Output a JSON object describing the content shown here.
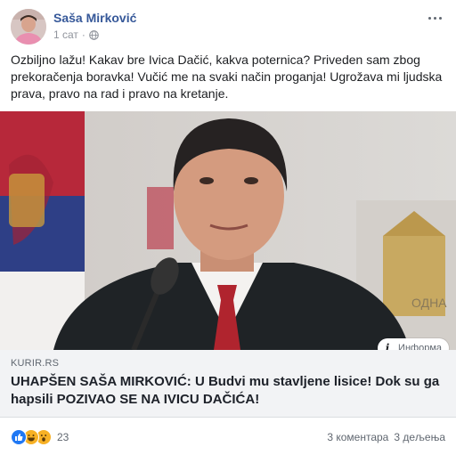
{
  "post": {
    "author": "Saša Mirković",
    "timestamp": "1 сат",
    "privacy_icon": "globe-icon",
    "text": "Ozbiljno lažu! Kakav bre Ivica Dačić, kakva poternica? Priveden sam zbog prekoračenja boravka! Vučić me na svaki način proganja! Ugrožava mi ljudska prava, pravo na rad i pravo na kretanje."
  },
  "link_preview": {
    "info_label": "Информа",
    "domain": "KURIR.RS",
    "title": "UHAPŠEN SAŠA MIRKOVIĆ: U Budvi mu stavljene lisice! Dok su ga hapsili POZIVAO SE NA IVICU DAČIĆA!"
  },
  "footer": {
    "reaction_icons": [
      "like-icon",
      "haha-icon",
      "wow-icon"
    ],
    "reaction_count": "23",
    "comments": "3 коментара",
    "shares": "3 дељења"
  },
  "colors": {
    "author": "#365899",
    "like": "#2078f4",
    "haha": "#f7b125"
  }
}
